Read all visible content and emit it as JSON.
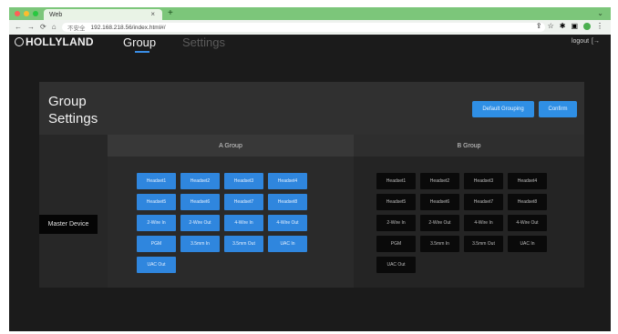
{
  "browser": {
    "tab_title": "Web",
    "tab_close": "×",
    "new_tab": "+",
    "window_controls": "⌄",
    "nav": [
      "←",
      "→",
      "⟳",
      "⌂"
    ],
    "security_label": "不安全",
    "url": "192.168.218.56/index.html#/",
    "colors": {
      "tabbar": "#7cc67a"
    }
  },
  "app": {
    "logo": "HOLLYLAND",
    "nav_tabs": [
      {
        "label": "Group",
        "active": true
      },
      {
        "label": "Settings",
        "active": false
      }
    ],
    "logout_label": "logout",
    "accent_color": "#2f8fe5"
  },
  "panel": {
    "title": "Group\nSettings",
    "default_grouping_label": "Default Grouping",
    "confirm_label": "Confirm",
    "master_device_label": "Master Device"
  },
  "groups": [
    {
      "title": "A Group",
      "devices": [
        "Headset1",
        "Headset2",
        "Headset3",
        "Headset4",
        "Headset5",
        "Headset6",
        "Headset7",
        "Headset8",
        "2-Wire In",
        "2-Wire Out",
        "4-Wire In",
        "4-Wire Out",
        "PGM",
        "3.5mm In",
        "3.5mm Out",
        "UAC In",
        "UAC Out"
      ]
    },
    {
      "title": "B Group",
      "devices": [
        "Headset1",
        "Headset2",
        "Headset3",
        "Headset4",
        "Headset5",
        "Headset6",
        "Headset7",
        "Headset8",
        "2-Wire In",
        "2-Wire Out",
        "4-Wire In",
        "4-Wire Out",
        "PGM",
        "3.5mm In",
        "3.5mm Out",
        "UAC In",
        "UAC Out"
      ]
    }
  ]
}
